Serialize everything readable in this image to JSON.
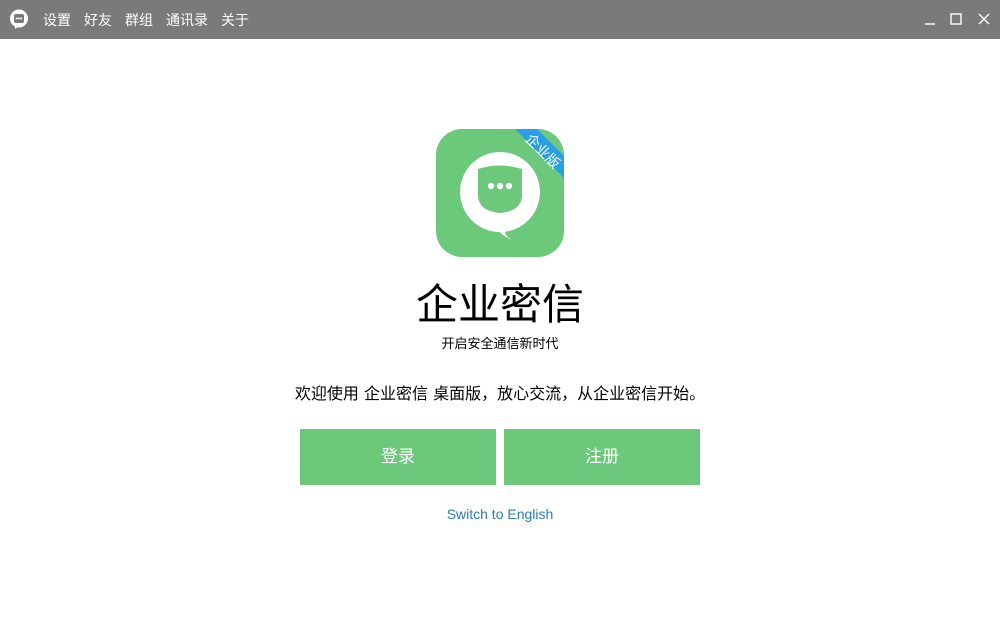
{
  "titlebar": {
    "menu": [
      {
        "label": "设置"
      },
      {
        "label": "好友"
      },
      {
        "label": "群组"
      },
      {
        "label": "通讯录"
      },
      {
        "label": "关于"
      }
    ],
    "controls": {
      "minimize_icon": "minimize-icon",
      "maximize_icon": "maximize-icon",
      "close_icon": "close-icon"
    }
  },
  "logo": {
    "badge_text": "企业版",
    "icon": "chat-bubble-icon"
  },
  "main": {
    "title": "企业密信",
    "subtitle": "开启安全通信新时代",
    "welcome": "欢迎使用 企业密信 桌面版，放心交流，从企业密信开始。",
    "login_label": "登录",
    "register_label": "注册",
    "switch_language": "Switch to English"
  },
  "colors": {
    "titlebar_bg": "#7a7a7a",
    "brand_green": "#6cc87a",
    "badge_blue": "#2a9ee8",
    "link_blue": "#2a7db8"
  }
}
